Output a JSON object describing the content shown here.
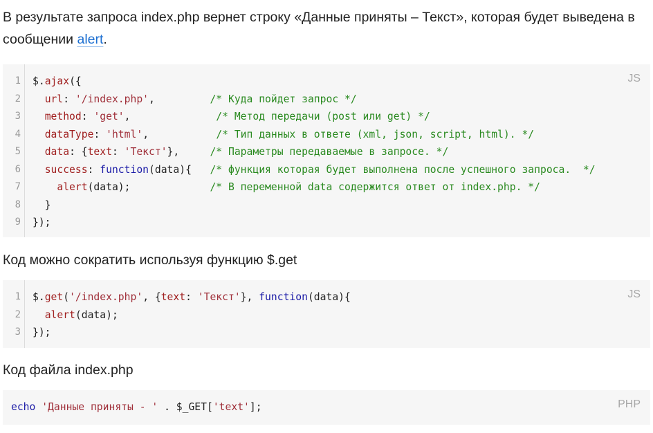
{
  "intro": {
    "text_before": "В результате запроса index.php вернет строку «Данные приняты – Текст», которая будет выведена в сообщении ",
    "link": "alert",
    "text_after": "."
  },
  "block1": {
    "lang": "JS",
    "line_numbers": [
      "1",
      "2",
      "3",
      "4",
      "5",
      "6",
      "7",
      "8",
      "9"
    ],
    "lines": [
      [
        {
          "c": "pn",
          "t": "$."
        },
        {
          "c": "prop",
          "t": "ajax"
        },
        {
          "c": "pn",
          "t": "({"
        }
      ],
      [
        {
          "c": "pn",
          "t": "  "
        },
        {
          "c": "prop",
          "t": "url"
        },
        {
          "c": "pn",
          "t": ": "
        },
        {
          "c": "str",
          "t": "'/index.php'"
        },
        {
          "c": "pn",
          "t": ",         "
        },
        {
          "c": "cm",
          "t": "/* Куда пойдет запрос */"
        }
      ],
      [
        {
          "c": "pn",
          "t": "  "
        },
        {
          "c": "prop",
          "t": "method"
        },
        {
          "c": "pn",
          "t": ": "
        },
        {
          "c": "str",
          "t": "'get'"
        },
        {
          "c": "pn",
          "t": ",              "
        },
        {
          "c": "cm",
          "t": "/* Метод передачи (post или get) */"
        }
      ],
      [
        {
          "c": "pn",
          "t": "  "
        },
        {
          "c": "prop",
          "t": "dataType"
        },
        {
          "c": "pn",
          "t": ": "
        },
        {
          "c": "str",
          "t": "'html'"
        },
        {
          "c": "pn",
          "t": ",           "
        },
        {
          "c": "cm",
          "t": "/* Тип данных в ответе (xml, json, script, html). */"
        }
      ],
      [
        {
          "c": "pn",
          "t": "  "
        },
        {
          "c": "prop",
          "t": "data"
        },
        {
          "c": "pn",
          "t": ": {"
        },
        {
          "c": "prop",
          "t": "text"
        },
        {
          "c": "pn",
          "t": ": "
        },
        {
          "c": "str",
          "t": "'Текст'"
        },
        {
          "c": "pn",
          "t": "},     "
        },
        {
          "c": "cm",
          "t": "/* Параметры передаваемые в запросе. */"
        }
      ],
      [
        {
          "c": "pn",
          "t": "  "
        },
        {
          "c": "prop",
          "t": "success"
        },
        {
          "c": "pn",
          "t": ": "
        },
        {
          "c": "kw",
          "t": "function"
        },
        {
          "c": "pn",
          "t": "(data){   "
        },
        {
          "c": "cm",
          "t": "/* функция которая будет выполнена после успешного запроса.  */"
        }
      ],
      [
        {
          "c": "pn",
          "t": "    "
        },
        {
          "c": "prop",
          "t": "alert"
        },
        {
          "c": "pn",
          "t": "(data);             "
        },
        {
          "c": "cm",
          "t": "/* В переменной data содержится ответ от index.php. */"
        }
      ],
      [
        {
          "c": "pn",
          "t": "  }"
        }
      ],
      [
        {
          "c": "pn",
          "t": "});"
        }
      ]
    ]
  },
  "para2": "Код можно сократить используя функцию $.get",
  "block2": {
    "lang": "JS",
    "line_numbers": [
      "1",
      "2",
      "3"
    ],
    "lines": [
      [
        {
          "c": "pn",
          "t": "$."
        },
        {
          "c": "prop",
          "t": "get"
        },
        {
          "c": "pn",
          "t": "("
        },
        {
          "c": "str",
          "t": "'/index.php'"
        },
        {
          "c": "pn",
          "t": ", {"
        },
        {
          "c": "prop",
          "t": "text"
        },
        {
          "c": "pn",
          "t": ": "
        },
        {
          "c": "str",
          "t": "'Текст'"
        },
        {
          "c": "pn",
          "t": "}, "
        },
        {
          "c": "kw",
          "t": "function"
        },
        {
          "c": "pn",
          "t": "(data){"
        }
      ],
      [
        {
          "c": "pn",
          "t": "  "
        },
        {
          "c": "prop",
          "t": "alert"
        },
        {
          "c": "pn",
          "t": "(data);"
        }
      ],
      [
        {
          "c": "pn",
          "t": "});"
        }
      ]
    ]
  },
  "para3": "Код файла index.php",
  "block3": {
    "lang": "PHP",
    "lines": [
      [
        {
          "c": "kw",
          "t": "echo"
        },
        {
          "c": "pn",
          "t": " "
        },
        {
          "c": "str",
          "t": "'Данные приняты - '"
        },
        {
          "c": "pn",
          "t": " . $_GET["
        },
        {
          "c": "str",
          "t": "'text'"
        },
        {
          "c": "pn",
          "t": "];"
        }
      ]
    ]
  }
}
